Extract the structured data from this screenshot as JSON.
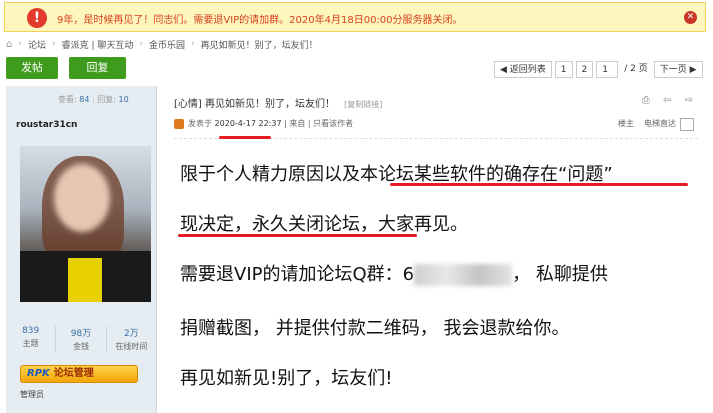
{
  "notice": {
    "icon": "exclamation-icon",
    "text": "9年，是时候再见了！同志们。需要退VIP的请加群。2020年4月18日00:00分服务器关闭。",
    "close_icon": "close-icon"
  },
  "breadcrumb": {
    "items": [
      "论坛",
      "睿派克 | 聊天互动",
      "金币乐园",
      "再见如新见！别了，坛友们！"
    ],
    "separator": "›"
  },
  "toolbar": {
    "post_label": "发帖",
    "reply_label": "回复",
    "back_label": "◀ 返回列表",
    "pages": [
      "1",
      "2"
    ],
    "page_input_value": "1",
    "page_total": "/ 2 页",
    "next_label": "下一页 ▶"
  },
  "author": {
    "views_label": "查看:",
    "views": "84",
    "replies_label": "回复:",
    "replies": "10",
    "username": "roustar31cn",
    "stats": [
      {
        "value": "839",
        "label": "主题"
      },
      {
        "value": "98万",
        "label": "金钱"
      },
      {
        "value": "2万",
        "label": "在线时间"
      }
    ],
    "badge_logo": "RPK",
    "badge_text": "论坛管理",
    "role": "管理员"
  },
  "post": {
    "title": "[心情] 再见如新见！别了，坛友们！",
    "copy_link": "[复制链接]",
    "tool_icons": "⎙ ⇦ ⇨",
    "posted_prefix": "发表于",
    "posted_date": "2020-4-17 22:37",
    "posted_suffix": " | 来自    | 只看该作者",
    "floor": "楼主",
    "direct": "电梯直达",
    "lines": [
      "限于个人精力原因以及本论坛某些软件的确存在“问题”",
      "现决定，永久关闭论坛，大家再见。",
      "需要退VIP的请加论坛Q群：6",
      "，  私聊提供",
      "捐赠截图，  并提供付款二维码，  我会退款给你。",
      "再见如新见!别了，坛友们!"
    ]
  },
  "colors": {
    "accent_green": "#3f9b1d",
    "notice_bg": "#fdf7bd",
    "notice_text": "#d7401d",
    "highlight_red": "#e51c23"
  }
}
